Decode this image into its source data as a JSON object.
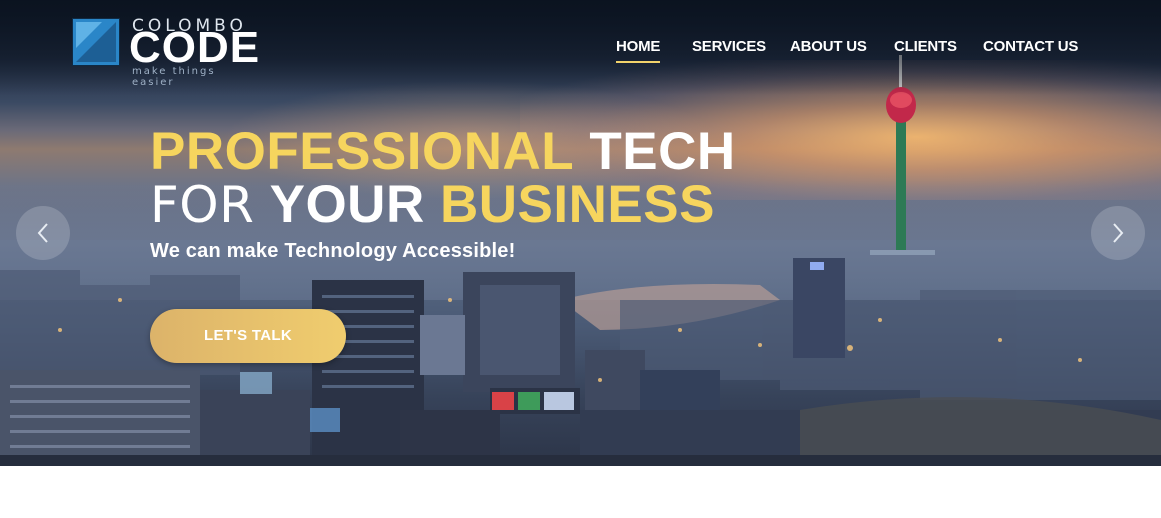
{
  "brand": {
    "name_top": "COLOMBO",
    "name_main": "CODE",
    "tagline": "make things easier",
    "logo_icon": "logo-square-icon"
  },
  "nav": {
    "items": [
      {
        "label": "HOME",
        "active": true
      },
      {
        "label": "SERVICES",
        "active": false
      },
      {
        "label": "ABOUT US",
        "active": false
      },
      {
        "label": "CLIENTS",
        "active": false
      },
      {
        "label": "CONTACT US",
        "active": false
      }
    ]
  },
  "hero": {
    "headline_line1_part1": "PROFESSIONAL",
    "headline_line1_part2": "TECH",
    "headline_line2_part1": "FOR",
    "headline_line2_part2": "YOUR",
    "headline_line2_part3": "BUSINESS",
    "subheadline": "We can make Technology Accessible!",
    "cta_label": "LET'S TALK",
    "prev_icon": "chevron-left-icon",
    "next_icon": "chevron-right-icon"
  },
  "colors": {
    "accent_yellow": "#f6d55e",
    "cta_gradient_start": "#dcb36a",
    "cta_gradient_end": "#f0cd6e",
    "nav_text": "#ffffff",
    "logo_blue": "#2a86c8"
  }
}
